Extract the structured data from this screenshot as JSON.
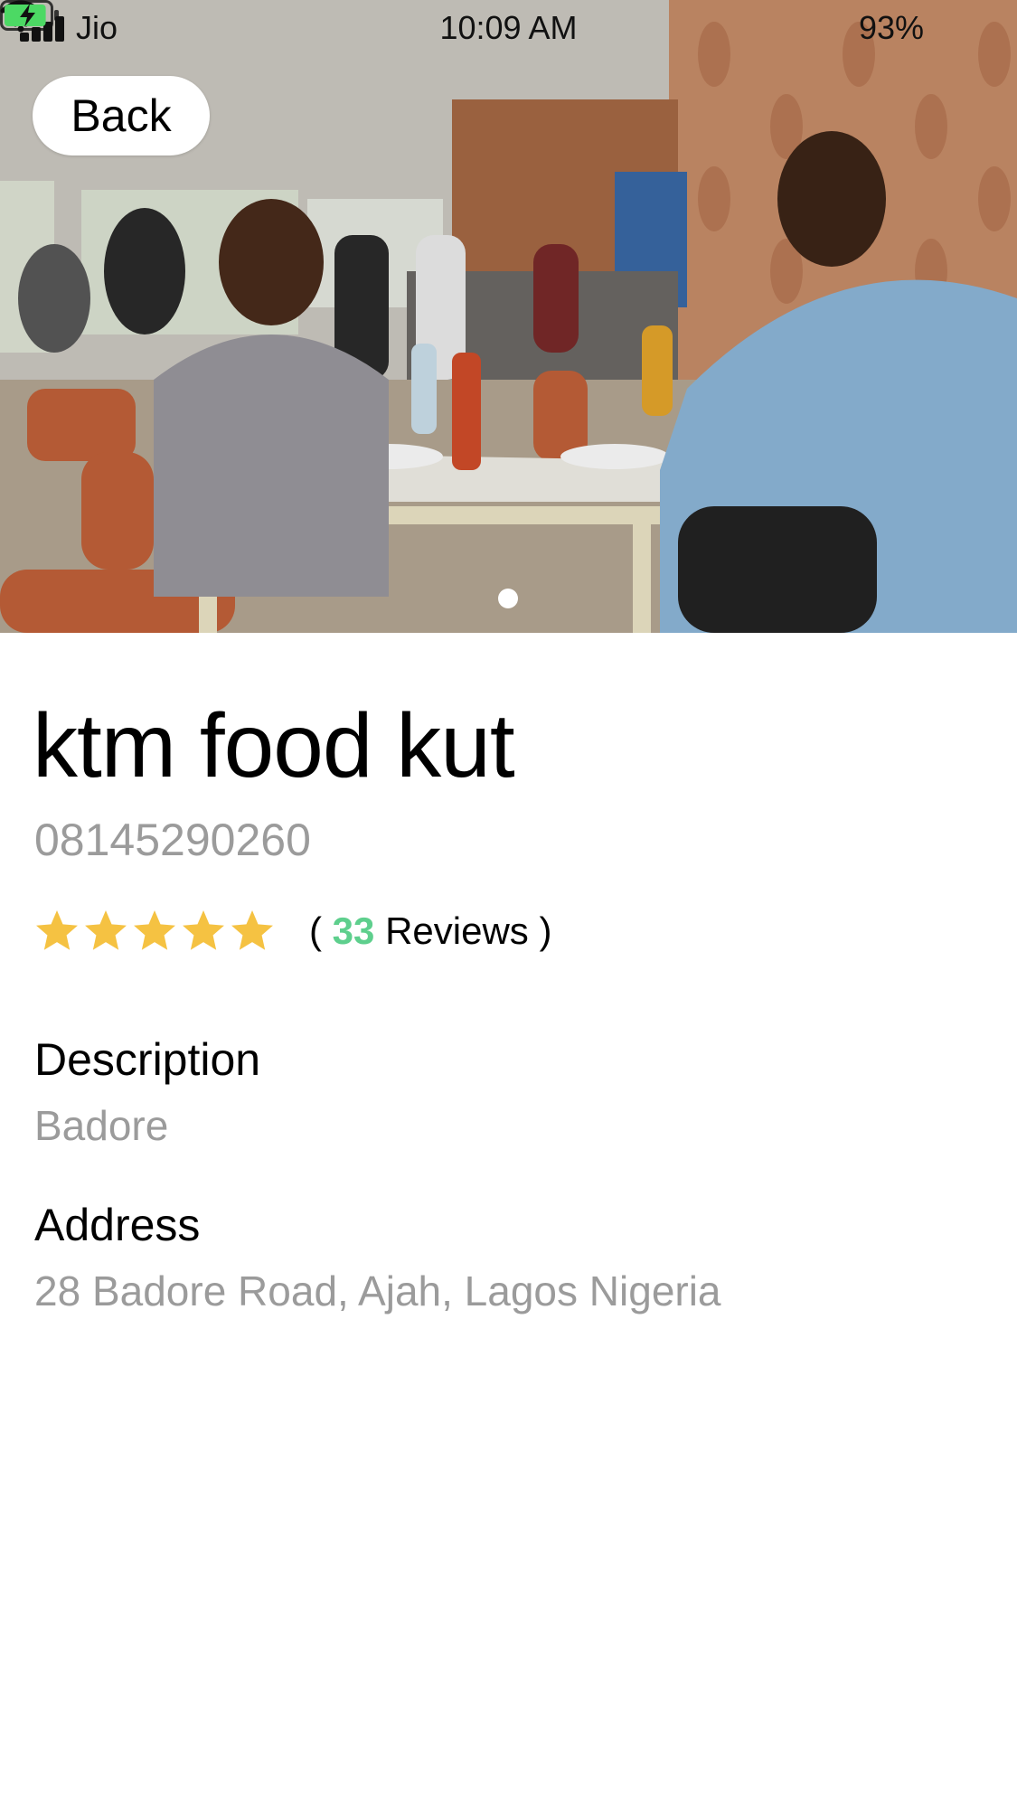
{
  "status_bar": {
    "carrier": "Jio",
    "time": "10:09 AM",
    "battery_percent": "93%",
    "battery_level": 0.93,
    "icons": [
      "signal-icon",
      "wifi-icon",
      "location-arrow-icon",
      "battery-charging-icon"
    ]
  },
  "header": {
    "back_label": "Back"
  },
  "gallery": {
    "current_index": 1,
    "total": 1
  },
  "restaurant": {
    "name": "ktm food kut",
    "phone": "08145290260",
    "rating": 5,
    "rating_max": 5,
    "reviews_open": "(",
    "reviews_count": "33",
    "reviews_label": "Reviews )",
    "description_label": "Description",
    "description": "Badore",
    "address_label": "Address",
    "address": "28 Badore Road, Ajah, Lagos Nigeria"
  },
  "colors": {
    "star": "#f5c242",
    "reviews_count": "#5ecf8d",
    "muted_text": "#9b9b9b",
    "battery_fill": "#4cd964"
  }
}
